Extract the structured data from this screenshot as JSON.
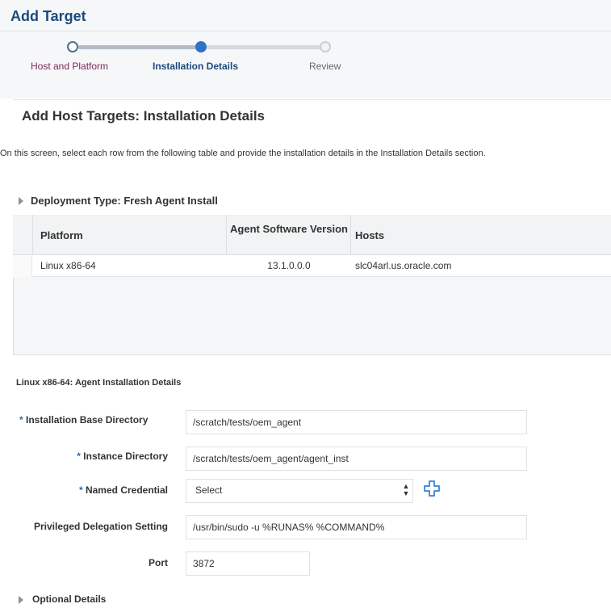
{
  "header": {
    "title": "Add Target"
  },
  "train": {
    "steps": [
      {
        "label": "Host and Platform",
        "state": "visited"
      },
      {
        "label": "Installation Details",
        "state": "current"
      },
      {
        "label": "Review",
        "state": "unvisited"
      }
    ]
  },
  "section": {
    "title": "Add Host Targets: Installation Details",
    "instructions": "On this screen, select each row from the following table and provide the installation details in the Installation Details section."
  },
  "deployment": {
    "title": "Deployment Type: Fresh Agent Install",
    "columns": [
      "Platform",
      "Agent Software Version",
      "Hosts"
    ],
    "rows": [
      {
        "platform": "Linux x86-64",
        "version": "13.1.0.0.0",
        "hosts": "slc04arl.us.oracle.com"
      }
    ]
  },
  "details": {
    "title": "Linux x86-64: Agent Installation Details",
    "required_marker": "*",
    "fields": {
      "base_dir": {
        "label": "Installation Base Directory",
        "value": "/scratch/tests/oem_agent"
      },
      "instance_dir": {
        "label": "Instance Directory",
        "value": "/scratch/tests/oem_agent/agent_inst"
      },
      "named_credential": {
        "label": "Named Credential",
        "value": "Select"
      },
      "privileged": {
        "label": "Privileged Delegation Setting",
        "value": "/usr/bin/sudo -u %RUNAS% %COMMAND%"
      },
      "port": {
        "label": "Port",
        "value": "3872"
      }
    }
  },
  "optional": {
    "title": "Optional Details"
  },
  "colors": {
    "title": "#1c4a7d",
    "current_step": "#2e72c6",
    "visited_label": "#7c2a5b",
    "required": "#2d68b5",
    "add_icon": "#4f8fd6"
  },
  "icons": {
    "deploy_toggle": "triangle-right-icon",
    "optional_toggle": "triangle-right-icon",
    "add_credential": "plus-icon",
    "select_arrows": "up-down-arrows-icon"
  }
}
